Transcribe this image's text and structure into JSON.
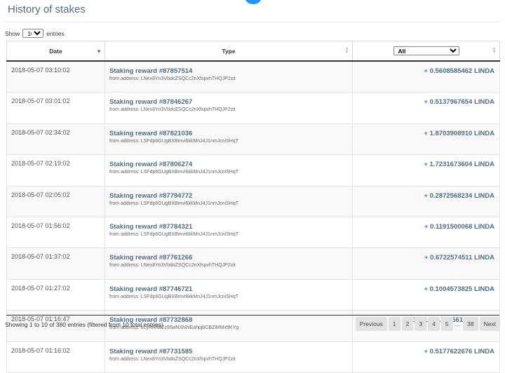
{
  "header": {
    "title": "History of stakes"
  },
  "length_control": {
    "show_label": "Show",
    "value": "10",
    "entries_label": "entries"
  },
  "table": {
    "columns": {
      "date": "Date",
      "type": "Type"
    },
    "filter": {
      "selected": "All"
    },
    "rows": [
      {
        "date": "2018-05-07 03:10:02",
        "title": "Staking reward #87857514",
        "from": "from address: LNex8Yn3VbdoZSQCc2nXfspvhTHQJP2zit",
        "amount": "+ 0.5608585462 LINDA"
      },
      {
        "date": "2018-05-07 03:01:02",
        "title": "Staking reward #87846267",
        "from": "from address: LNex8Yn3VbdoZSQCc2nXfspvhTHQJP2zit",
        "amount": "+ 0.5137967654 LINDA"
      },
      {
        "date": "2018-05-07 02:34:02",
        "title": "Staking reward #87821036",
        "from": "from address: LSFdp6GUgBXBmvi6kkMnJ4J1nmJcniSHqT",
        "amount": "+ 1.8703908910 LINDA"
      },
      {
        "date": "2018-05-07 02:19:02",
        "title": "Staking reward #87806274",
        "from": "from address: LSFdp6GUgBXBmvi6kkMnJ4J1nmJcniSHqT",
        "amount": "+ 1.7231673604 LINDA"
      },
      {
        "date": "2018-05-07 02:05:02",
        "title": "Staking reward #87794772",
        "from": "from address: LSFdp6GUgBXBmvi6kkMnJ4J1nmJcniSHqT",
        "amount": "+ 0.2872568234 LINDA"
      },
      {
        "date": "2018-05-07 01:56:02",
        "title": "Staking reward #87784321",
        "from": "from address: LSFdp6GUgBXBmvi6kkMnJ4J1nmJcniSHqT",
        "amount": "+ 0.1191500068 LINDA"
      },
      {
        "date": "2018-05-07 01:37:02",
        "title": "Staking reward #87761266",
        "from": "from address: LNex8Yn3VbdoZSQCc2nXfspvhTHQJP2zit",
        "amount": "+ 0.6722574511 LINDA"
      },
      {
        "date": "2018-05-07 01:27:02",
        "title": "Staking reward #87746721",
        "from": "from address: LSFdp6GUgBXBmvi6kkMnJ4J1nmJcniSHqT",
        "amount": "+ 0.1004573825 LINDA"
      },
      {
        "date": "2018-05-07 01:16:47",
        "title": "Staking reward #87732868",
        "from": "from address: eLyRAN82z9SaNXNhiEahpjbCBZiMMx9KYg",
        "amount": "+ 1231053.7305612583 EMB"
      },
      {
        "date": "2018-05-07 01:16:02",
        "title": "Staking reward #87731585",
        "from": "from address: LNex8Yn3VbdoZSQCc2nXfspvhTHQJP2zit",
        "amount": "+ 0.5177622676 LINDA"
      }
    ]
  },
  "info": "Showing 1 to 10 of 380 entries (filtered from 10 total entries)",
  "pagination": {
    "previous": "Previous",
    "pages": [
      "1",
      "2",
      "3",
      "4",
      "5"
    ],
    "ellipsis": "…",
    "last": "38",
    "next": "Next"
  },
  "colors": {
    "accent": "#2196f3",
    "title": "#4d6e85",
    "positive": "#25a36f"
  }
}
